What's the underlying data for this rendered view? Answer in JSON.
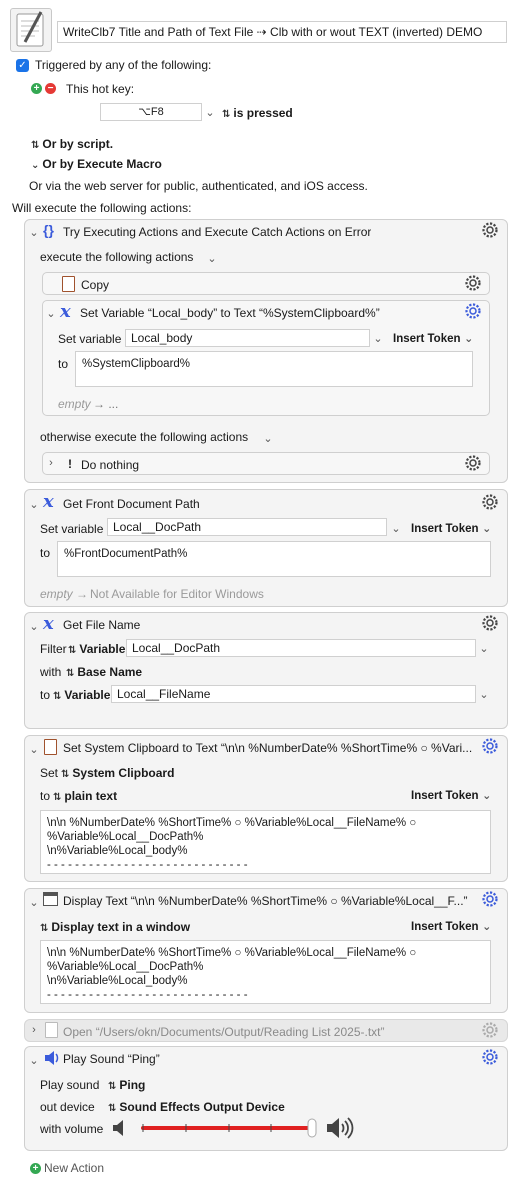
{
  "macro": {
    "name": "WriteClb7 Title and Path of Text File  ⇢ Clb with or wout TEXT (inverted) DEMO"
  },
  "triggers": {
    "header": "Triggered by any of the following:",
    "hotkey_label": "This hot key:",
    "hotkey_value": "⌥F8",
    "hotkey_condition": "is pressed",
    "or_script": "Or by script.",
    "or_execute_macro": "Or by Execute Macro",
    "web_server": "Or via the web server for public, authenticated, and iOS access."
  },
  "actions_header": "Will execute the following actions:",
  "try_action": {
    "title": "Try Executing Actions and Execute Catch Actions on Error",
    "execute_label": "execute the following actions",
    "copy_title": "Copy",
    "set_var": {
      "title": "Set Variable “Local_body” to Text “%SystemClipboard%”",
      "set_label": "Set variable",
      "var_name": "Local_body",
      "insert_token": "Insert Token",
      "to_label": "to",
      "value": "%SystemClipboard%",
      "empty_label": "empty",
      "empty_arrow": "→ ..."
    },
    "otherwise_label": "otherwise execute the following actions",
    "do_nothing_title": "Do nothing"
  },
  "front_doc": {
    "title": "Get Front Document Path",
    "set_label": "Set variable",
    "var_name": "Local__DocPath",
    "insert_token": "Insert Token",
    "to_label": "to",
    "value": "%FrontDocumentPath%",
    "empty_label": "empty",
    "empty_note": "Not Available for Editor Windows"
  },
  "file_name": {
    "title": "Get File Name",
    "filter_label": "Filter",
    "variable_label": "Variable",
    "filter_var": "Local__DocPath",
    "with_label": "with",
    "base_name": "Base Name",
    "to_label": "to",
    "to_variable_label": "Variable",
    "to_var": "Local__FileName"
  },
  "set_clipboard": {
    "title": "Set System Clipboard to Text “\\n\\n %NumberDate% %ShortTime% ○ %Vari...",
    "set_label": "Set",
    "clipboard_label": "System Clipboard",
    "to_label": "to",
    "plain_text": "plain text",
    "insert_token": "Insert Token",
    "text": "\\n\\n %NumberDate% %ShortTime% ○ %Variable%Local__FileName% ○\n%Variable%Local__DocPath%\n\\n%Variable%Local_body%\n- - - - - - - - - - - - - - - - - - - - - - - - - - - - -"
  },
  "display_text": {
    "title": "Display Text “\\n\\n %NumberDate% %ShortTime% ○ %Variable%Local__F...”",
    "mode_label": "Display text in a window",
    "insert_token": "Insert Token",
    "text": "\\n\\n %NumberDate% %ShortTime% ○ %Variable%Local__FileName% ○\n%Variable%Local__DocPath%\n\\n%Variable%Local_body%\n- - - - - - - - - - - - - - - - - - - - - - - - - - - - -"
  },
  "open_action": {
    "title": "Open “/Users/okn/Documents/Output/Reading List 2025-.txt”"
  },
  "play_sound": {
    "title": "Play Sound “Ping”",
    "play_label": "Play sound",
    "sound": "Ping",
    "out_label": "out device",
    "device": "Sound Effects Output Device",
    "volume_label": "with volume",
    "volume_level": 1.0
  },
  "new_action": "New Action",
  "colors": {
    "accent_blue": "#1a73e8",
    "slider_red": "#e02020",
    "icon_blue": "#3b5bdb",
    "add_green": "#34a853",
    "remove_red": "#e53935"
  }
}
